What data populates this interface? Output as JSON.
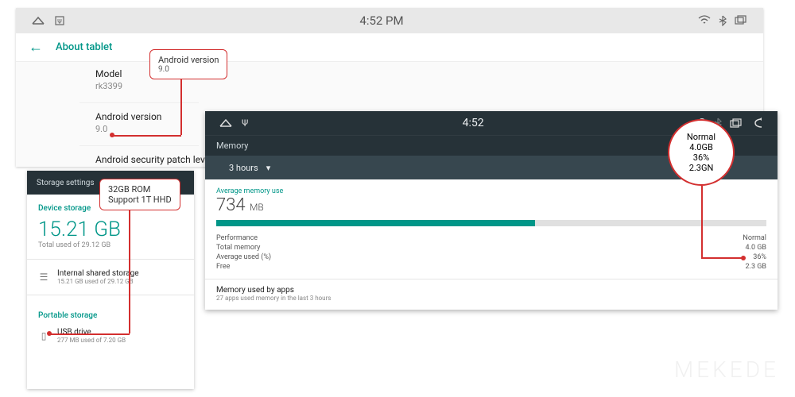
{
  "panel1": {
    "statusbar": {
      "time": "4:52 PM"
    },
    "header": {
      "title": "About tablet"
    },
    "items": {
      "model": {
        "label": "Model",
        "value": "rk3399"
      },
      "android": {
        "label": "Android version",
        "value": "9.0"
      },
      "patch": {
        "label": "Android security patch level"
      }
    }
  },
  "panel2": {
    "header": "Storage settings",
    "device_section": "Device storage",
    "storage_used": "15.21 GB",
    "storage_total": "Total used of 29.12 GB",
    "internal": {
      "label": "Internal shared storage",
      "sub": "15.21 GB used of 29.12 GB"
    },
    "portable_section": "Portable storage",
    "usb": {
      "label": "USB drive",
      "sub": "277 MB used of 7.20 GB"
    }
  },
  "panel3": {
    "statusbar": {
      "time": "4:52"
    },
    "title": "Memory",
    "filter": "3 hours",
    "avg_label": "Average memory use",
    "avg_value": "734",
    "avg_unit": "MB",
    "stats_left": [
      "Performance",
      "Total memory",
      "Average used (%)",
      "Free"
    ],
    "stats_right": [
      "Normal",
      "4.0 GB",
      "36%",
      "2.3 GB"
    ],
    "apps": {
      "label": "Memory used by apps",
      "sub": "27 apps used memory in the last 3 hours"
    }
  },
  "callouts": {
    "android": {
      "title": "Android version",
      "value": "9.0"
    },
    "rom": {
      "line1": "32GB ROM",
      "line2": "Support 1T HHD"
    },
    "memory": {
      "line1": "Normal",
      "line2": "4.0GB",
      "line3": "36%",
      "line4": "2.3GN"
    }
  },
  "watermark": "MEKEDE"
}
